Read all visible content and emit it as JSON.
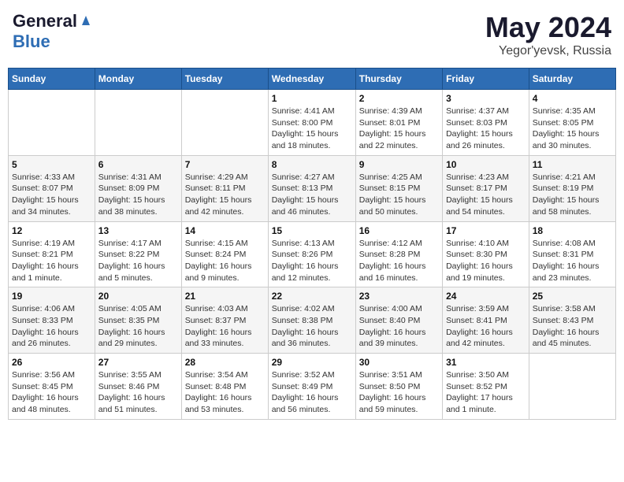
{
  "header": {
    "logo_general": "General",
    "logo_blue": "Blue",
    "month_title": "May 2024",
    "location": "Yegor'yevsk, Russia"
  },
  "days_of_week": [
    "Sunday",
    "Monday",
    "Tuesday",
    "Wednesday",
    "Thursday",
    "Friday",
    "Saturday"
  ],
  "weeks": [
    [
      {
        "num": "",
        "info": ""
      },
      {
        "num": "",
        "info": ""
      },
      {
        "num": "",
        "info": ""
      },
      {
        "num": "1",
        "info": "Sunrise: 4:41 AM\nSunset: 8:00 PM\nDaylight: 15 hours and 18 minutes."
      },
      {
        "num": "2",
        "info": "Sunrise: 4:39 AM\nSunset: 8:01 PM\nDaylight: 15 hours and 22 minutes."
      },
      {
        "num": "3",
        "info": "Sunrise: 4:37 AM\nSunset: 8:03 PM\nDaylight: 15 hours and 26 minutes."
      },
      {
        "num": "4",
        "info": "Sunrise: 4:35 AM\nSunset: 8:05 PM\nDaylight: 15 hours and 30 minutes."
      }
    ],
    [
      {
        "num": "5",
        "info": "Sunrise: 4:33 AM\nSunset: 8:07 PM\nDaylight: 15 hours and 34 minutes."
      },
      {
        "num": "6",
        "info": "Sunrise: 4:31 AM\nSunset: 8:09 PM\nDaylight: 15 hours and 38 minutes."
      },
      {
        "num": "7",
        "info": "Sunrise: 4:29 AM\nSunset: 8:11 PM\nDaylight: 15 hours and 42 minutes."
      },
      {
        "num": "8",
        "info": "Sunrise: 4:27 AM\nSunset: 8:13 PM\nDaylight: 15 hours and 46 minutes."
      },
      {
        "num": "9",
        "info": "Sunrise: 4:25 AM\nSunset: 8:15 PM\nDaylight: 15 hours and 50 minutes."
      },
      {
        "num": "10",
        "info": "Sunrise: 4:23 AM\nSunset: 8:17 PM\nDaylight: 15 hours and 54 minutes."
      },
      {
        "num": "11",
        "info": "Sunrise: 4:21 AM\nSunset: 8:19 PM\nDaylight: 15 hours and 58 minutes."
      }
    ],
    [
      {
        "num": "12",
        "info": "Sunrise: 4:19 AM\nSunset: 8:21 PM\nDaylight: 16 hours and 1 minute."
      },
      {
        "num": "13",
        "info": "Sunrise: 4:17 AM\nSunset: 8:22 PM\nDaylight: 16 hours and 5 minutes."
      },
      {
        "num": "14",
        "info": "Sunrise: 4:15 AM\nSunset: 8:24 PM\nDaylight: 16 hours and 9 minutes."
      },
      {
        "num": "15",
        "info": "Sunrise: 4:13 AM\nSunset: 8:26 PM\nDaylight: 16 hours and 12 minutes."
      },
      {
        "num": "16",
        "info": "Sunrise: 4:12 AM\nSunset: 8:28 PM\nDaylight: 16 hours and 16 minutes."
      },
      {
        "num": "17",
        "info": "Sunrise: 4:10 AM\nSunset: 8:30 PM\nDaylight: 16 hours and 19 minutes."
      },
      {
        "num": "18",
        "info": "Sunrise: 4:08 AM\nSunset: 8:31 PM\nDaylight: 16 hours and 23 minutes."
      }
    ],
    [
      {
        "num": "19",
        "info": "Sunrise: 4:06 AM\nSunset: 8:33 PM\nDaylight: 16 hours and 26 minutes."
      },
      {
        "num": "20",
        "info": "Sunrise: 4:05 AM\nSunset: 8:35 PM\nDaylight: 16 hours and 29 minutes."
      },
      {
        "num": "21",
        "info": "Sunrise: 4:03 AM\nSunset: 8:37 PM\nDaylight: 16 hours and 33 minutes."
      },
      {
        "num": "22",
        "info": "Sunrise: 4:02 AM\nSunset: 8:38 PM\nDaylight: 16 hours and 36 minutes."
      },
      {
        "num": "23",
        "info": "Sunrise: 4:00 AM\nSunset: 8:40 PM\nDaylight: 16 hours and 39 minutes."
      },
      {
        "num": "24",
        "info": "Sunrise: 3:59 AM\nSunset: 8:41 PM\nDaylight: 16 hours and 42 minutes."
      },
      {
        "num": "25",
        "info": "Sunrise: 3:58 AM\nSunset: 8:43 PM\nDaylight: 16 hours and 45 minutes."
      }
    ],
    [
      {
        "num": "26",
        "info": "Sunrise: 3:56 AM\nSunset: 8:45 PM\nDaylight: 16 hours and 48 minutes."
      },
      {
        "num": "27",
        "info": "Sunrise: 3:55 AM\nSunset: 8:46 PM\nDaylight: 16 hours and 51 minutes."
      },
      {
        "num": "28",
        "info": "Sunrise: 3:54 AM\nSunset: 8:48 PM\nDaylight: 16 hours and 53 minutes."
      },
      {
        "num": "29",
        "info": "Sunrise: 3:52 AM\nSunset: 8:49 PM\nDaylight: 16 hours and 56 minutes."
      },
      {
        "num": "30",
        "info": "Sunrise: 3:51 AM\nSunset: 8:50 PM\nDaylight: 16 hours and 59 minutes."
      },
      {
        "num": "31",
        "info": "Sunrise: 3:50 AM\nSunset: 8:52 PM\nDaylight: 17 hours and 1 minute."
      },
      {
        "num": "",
        "info": ""
      }
    ]
  ]
}
